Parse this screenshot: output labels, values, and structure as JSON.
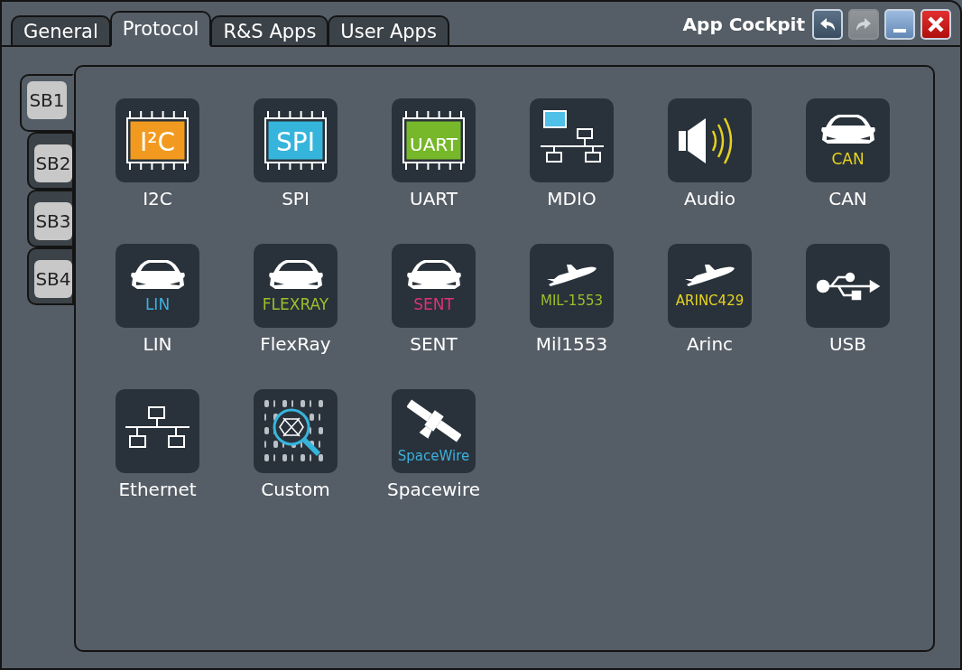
{
  "window": {
    "title": "App Cockpit"
  },
  "tabs": [
    {
      "label": "General",
      "selected": false
    },
    {
      "label": "Protocol",
      "selected": true
    },
    {
      "label": "R&S Apps",
      "selected": false
    },
    {
      "label": "User Apps",
      "selected": false
    }
  ],
  "title_buttons": [
    {
      "kind": "undo",
      "disabled": false
    },
    {
      "kind": "redo",
      "disabled": true
    },
    {
      "kind": "minimize",
      "disabled": false
    },
    {
      "kind": "close",
      "disabled": false
    }
  ],
  "side_tabs": [
    {
      "label": "SB1",
      "selected": true
    },
    {
      "label": "SB2",
      "selected": false
    },
    {
      "label": "SB3",
      "selected": false
    },
    {
      "label": "SB4",
      "selected": false
    }
  ],
  "apps": [
    {
      "label": "I2C",
      "kind": "chip",
      "badge": "I²C",
      "color": "#f29a1f"
    },
    {
      "label": "SPI",
      "kind": "chip",
      "badge": "SPI",
      "color": "#36b5dc"
    },
    {
      "label": "UART",
      "kind": "chip",
      "badge": "UART",
      "color": "#76b82a"
    },
    {
      "label": "MDIO",
      "kind": "mdio"
    },
    {
      "label": "Audio",
      "kind": "audio"
    },
    {
      "label": "CAN",
      "kind": "car",
      "badge": "CAN",
      "color": "#e6d21e"
    },
    {
      "label": "LIN",
      "kind": "car",
      "badge": "LIN",
      "color": "#3fb0dd"
    },
    {
      "label": "FlexRay",
      "kind": "car",
      "badge": "FLEXRAY",
      "color": "#9cbf2a"
    },
    {
      "label": "SENT",
      "kind": "car",
      "badge": "SENT",
      "color": "#e0307a"
    },
    {
      "label": "Mil1553",
      "kind": "plane",
      "badge": "MIL-1553",
      "color": "#9cbf2a"
    },
    {
      "label": "Arinc",
      "kind": "plane",
      "badge": "ARINC429",
      "color": "#e6d21e"
    },
    {
      "label": "USB",
      "kind": "usb"
    },
    {
      "label": "Ethernet",
      "kind": "ethernet"
    },
    {
      "label": "Custom",
      "kind": "custom"
    },
    {
      "label": "Spacewire",
      "kind": "satellite",
      "badge": "SpaceWire",
      "color": "#3fb0dd"
    }
  ]
}
